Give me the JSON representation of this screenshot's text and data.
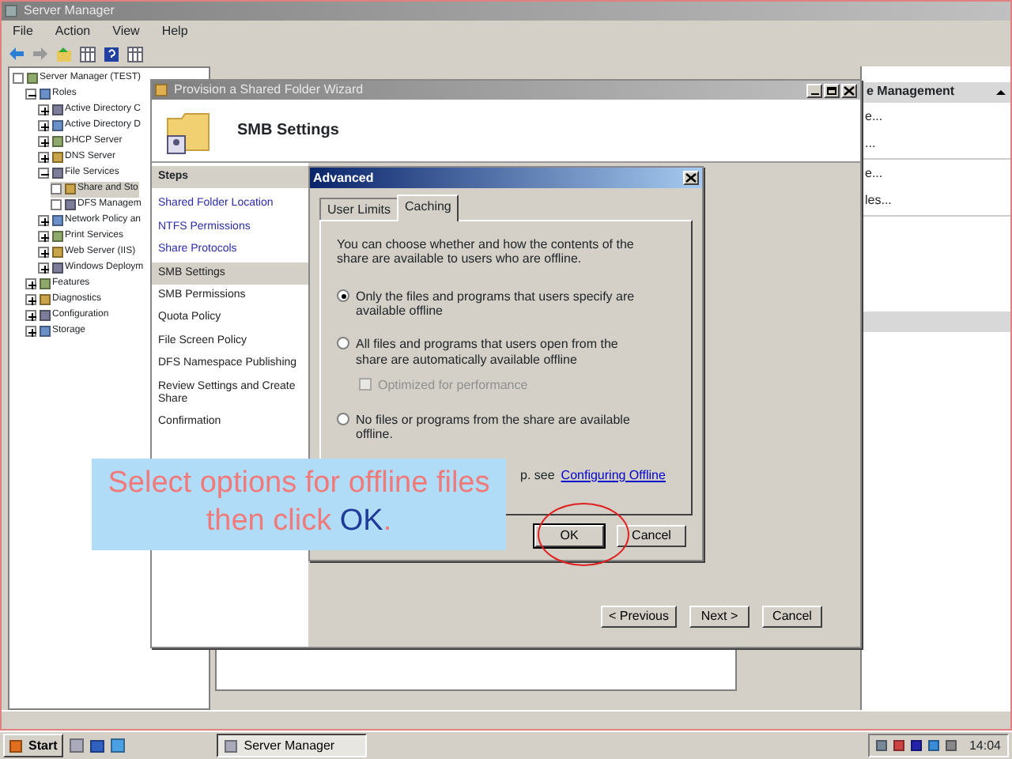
{
  "server_manager": {
    "title": "Server Manager",
    "menu": [
      "File",
      "Action",
      "View",
      "Help"
    ],
    "tree": [
      {
        "label": "Server Manager (TEST)",
        "selected": false,
        "children": [
          {
            "label": "Roles",
            "expanded": true,
            "selected": false,
            "children": [
              {
                "label": "Active Directory C",
                "expanded": false,
                "selected": false
              },
              {
                "label": "Active Directory D",
                "expanded": false,
                "selected": false
              },
              {
                "label": "DHCP Server",
                "expanded": false,
                "selected": false
              },
              {
                "label": "DNS Server",
                "expanded": false,
                "selected": false
              },
              {
                "label": "File Services",
                "expanded": true,
                "selected": false,
                "children": [
                  {
                    "label": "Share and Sto",
                    "selected": true
                  },
                  {
                    "label": "DFS Managem",
                    "selected": false
                  }
                ]
              },
              {
                "label": "Network Policy an",
                "expanded": false,
                "selected": false
              },
              {
                "label": "Print Services",
                "expanded": false,
                "selected": false
              },
              {
                "label": "Web Server (IIS)",
                "expanded": false,
                "selected": false
              },
              {
                "label": "Windows Deploym",
                "expanded": false,
                "selected": false
              }
            ]
          },
          {
            "label": "Features",
            "expanded": false,
            "selected": false
          },
          {
            "label": "Diagnostics",
            "expanded": false,
            "selected": false
          },
          {
            "label": "Configuration",
            "expanded": false,
            "selected": false
          },
          {
            "label": "Storage",
            "expanded": false,
            "selected": false
          }
        ]
      }
    ],
    "actions": {
      "header": "e Management",
      "items": [
        "e...",
        "...",
        "e...",
        "les..."
      ]
    }
  },
  "wizard": {
    "title": "Provision a Shared Folder Wizard",
    "page_title": "SMB Settings",
    "steps_heading": "Steps",
    "steps": [
      {
        "label": "Shared Folder Location",
        "completed": true,
        "selected": false
      },
      {
        "label": "NTFS Permissions",
        "completed": true,
        "selected": false
      },
      {
        "label": "Share Protocols",
        "completed": true,
        "selected": false
      },
      {
        "label": "SMB Settings",
        "completed": false,
        "selected": true
      },
      {
        "label": "SMB Permissions",
        "completed": false,
        "selected": false
      },
      {
        "label": "Quota Policy",
        "completed": false,
        "selected": false
      },
      {
        "label": "File Screen Policy",
        "completed": false,
        "selected": false
      },
      {
        "label": "DFS Namespace Publishing",
        "completed": false,
        "selected": false
      },
      {
        "label": "Review Settings and Create Share",
        "completed": false,
        "selected": false
      },
      {
        "label": "Confirmation",
        "completed": false,
        "selected": false
      }
    ],
    "buttons": [
      "< Previous",
      "Next >",
      "Cancel"
    ]
  },
  "advanced": {
    "title": "Advanced",
    "tabs": [
      {
        "label": "User Limits",
        "selected": false
      },
      {
        "label": "Caching",
        "selected": true
      }
    ],
    "description": "You can choose whether and how the contents of the share are available to users who are offline.",
    "options": [
      {
        "kind": "radio",
        "label": "Only the files and programs that users specify are available offline",
        "checked": true,
        "disabled": false
      },
      {
        "kind": "radio",
        "label": "All files and programs that users open from the share are automatically available offline",
        "checked": false,
        "disabled": false
      },
      {
        "kind": "checkbox",
        "label": "Optimized for performance",
        "checked": false,
        "disabled": true
      },
      {
        "kind": "radio",
        "label": "No files or programs from the share are available offline.",
        "checked": false,
        "disabled": false
      }
    ],
    "link_prefix": "p. see",
    "link": "Configuring Offline",
    "buttons": [
      "OK",
      "Cancel"
    ]
  },
  "callout": {
    "text": "Select options for offline files then click",
    "emphasis": "OK",
    "end": "."
  },
  "taskbar": {
    "start": "Start",
    "tasks": [
      {
        "label": "Server Manager",
        "selected": true
      }
    ],
    "clock": "14:04"
  }
}
